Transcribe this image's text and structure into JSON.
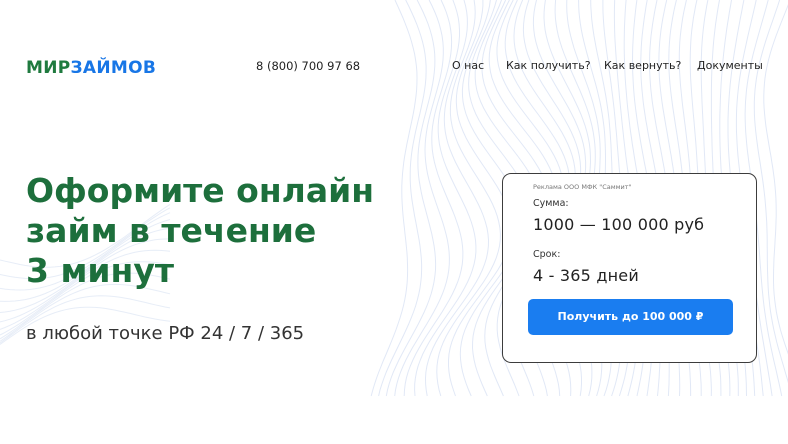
{
  "logo": {
    "part1": "МИР",
    "part2": "ЗАЙМОВ"
  },
  "header": {
    "phone": "8 (800) 700 97 68",
    "nav": [
      {
        "label": "О нас"
      },
      {
        "label": "Как получить?"
      },
      {
        "label": "Как вернуть?"
      },
      {
        "label": "Документы"
      }
    ]
  },
  "hero": {
    "title_lines": [
      "Оформите онлайн",
      "займ в течение",
      "3 минут"
    ],
    "subtitle": "в любой точке РФ 24 / 7 / 365"
  },
  "card": {
    "ad_note": "Реклама ООО МФК \"Саммит\"",
    "sum_label": "Сумма:",
    "sum_value": "1000 — 100 000 руб",
    "term_label": "Срок:",
    "term_value": "4 - 365 дней",
    "button_label": "Получить до 100 000 ₽"
  },
  "colors": {
    "brand_green": "#1d6f3c",
    "brand_blue": "#1876e6",
    "button_blue": "#1a7df0",
    "wave_lines": "#c9d6ee"
  }
}
